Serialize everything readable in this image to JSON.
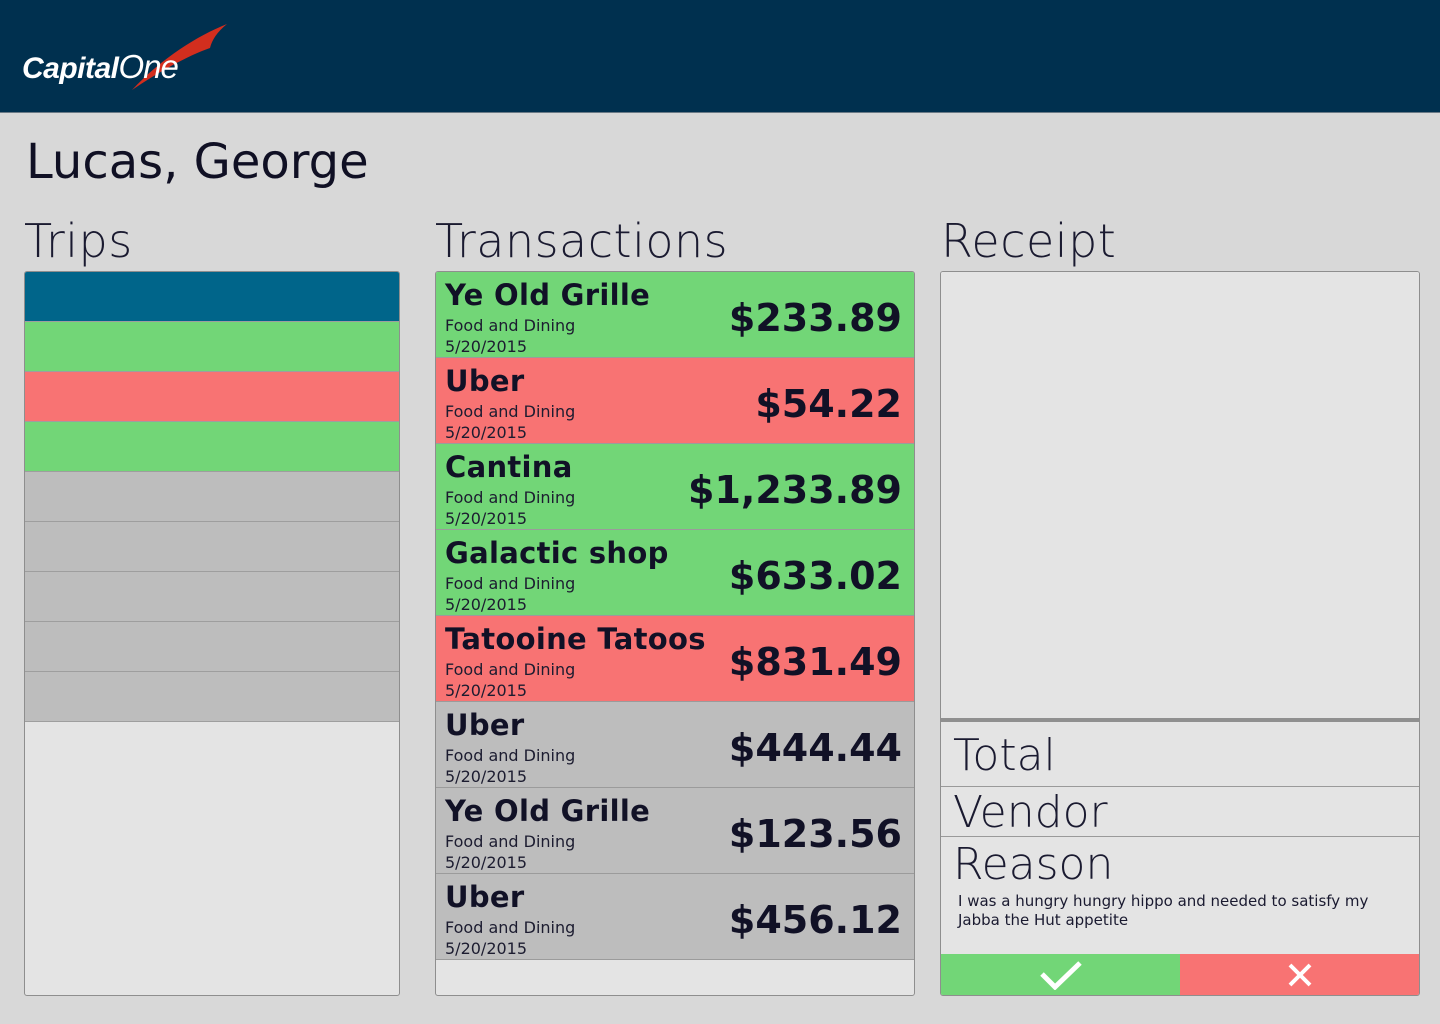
{
  "brand": {
    "logo_text_capital": "Capital",
    "logo_text_one": "One",
    "header_bg": "#00304f",
    "swoosh_color": "#d22e1e"
  },
  "user": {
    "name": "Lucas, George"
  },
  "colors": {
    "approved": "#72d677",
    "rejected": "#f87373",
    "pending": "#bdbdbd",
    "selected": "#00658a"
  },
  "trips": {
    "title": "Trips",
    "items": [
      {
        "status": "selected"
      },
      {
        "status": "approved"
      },
      {
        "status": "rejected"
      },
      {
        "status": "approved"
      },
      {
        "status": "pending"
      },
      {
        "status": "pending"
      },
      {
        "status": "pending"
      },
      {
        "status": "pending"
      },
      {
        "status": "pending"
      }
    ]
  },
  "transactions": {
    "title": "Transactions",
    "items": [
      {
        "vendor": "Ye Old Grille",
        "category": "Food and Dining",
        "date": "5/20/2015",
        "amount": "$233.89",
        "status": "approved"
      },
      {
        "vendor": "Uber",
        "category": "Food and Dining",
        "date": "5/20/2015",
        "amount": "$54.22",
        "status": "rejected"
      },
      {
        "vendor": "Cantina",
        "category": "Food and Dining",
        "date": "5/20/2015",
        "amount": "$1,233.89",
        "status": "approved"
      },
      {
        "vendor": "Galactic shop",
        "category": "Food and Dining",
        "date": "5/20/2015",
        "amount": "$633.02",
        "status": "approved"
      },
      {
        "vendor": "Tatooine Tatoos",
        "category": "Food and Dining",
        "date": "5/20/2015",
        "amount": "$831.49",
        "status": "rejected"
      },
      {
        "vendor": "Uber",
        "category": "Food and Dining",
        "date": "5/20/2015",
        "amount": "$444.44",
        "status": "pending"
      },
      {
        "vendor": "Ye Old Grille",
        "category": "Food and Dining",
        "date": "5/20/2015",
        "amount": "$123.56",
        "status": "pending"
      },
      {
        "vendor": "Uber",
        "category": "Food and Dining",
        "date": "5/20/2015",
        "amount": "$456.12",
        "status": "pending"
      }
    ]
  },
  "receipt": {
    "title": "Receipt",
    "total_label": "Total",
    "vendor_label": "Vendor",
    "reason_label": "Reason",
    "reason_text": "I was a hungry hungry hippo and needed to satisfy my Jabba the Hut appetite",
    "approve_icon": "checkmark-icon",
    "reject_icon": "x-icon"
  }
}
